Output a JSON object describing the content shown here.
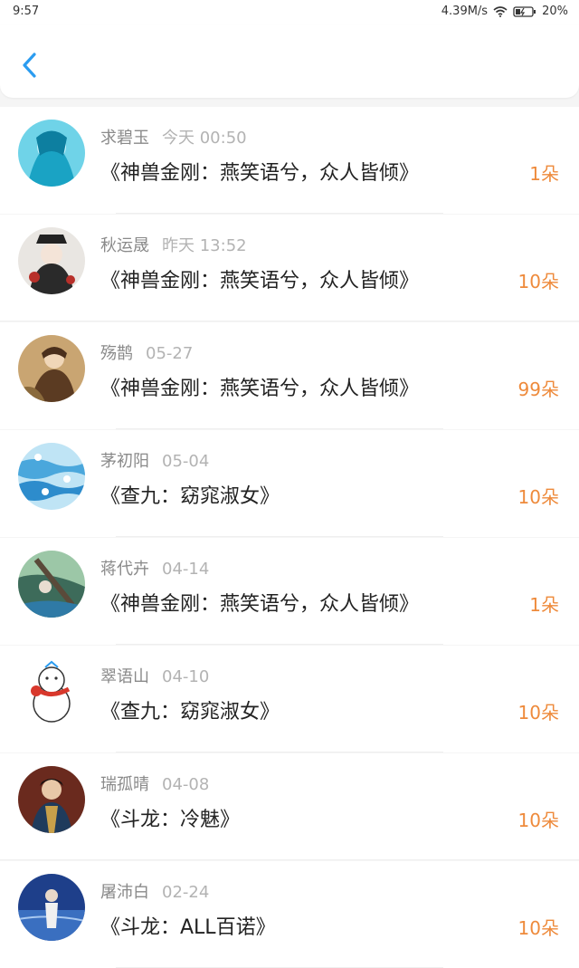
{
  "status": {
    "time": "9:57",
    "speed": "4.39M/s",
    "battery": "20%"
  },
  "header": {
    "back_icon": "chevron-left-icon",
    "accent": "#2b9cf0"
  },
  "items": [
    {
      "name": "求碧玉",
      "date": "今天 00:50",
      "title": "《神兽金刚：燕笑语兮，众人皆倾》",
      "count": "1朵"
    },
    {
      "name": "秋运晟",
      "date": "昨天 13:52",
      "title": "《神兽金刚：燕笑语兮，众人皆倾》",
      "count": "10朵"
    },
    {
      "name": "殇鹊",
      "date": "05-27",
      "title": "《神兽金刚：燕笑语兮，众人皆倾》",
      "count": "99朵"
    },
    {
      "name": "茅初阳",
      "date": "05-04",
      "title": "《查九：窈窕淑女》",
      "count": "10朵"
    },
    {
      "name": "蒋代卉",
      "date": "04-14",
      "title": "《神兽金刚：燕笑语兮，众人皆倾》",
      "count": "1朵"
    },
    {
      "name": "翠语山",
      "date": "04-10",
      "title": "《查九：窈窕淑女》",
      "count": "10朵"
    },
    {
      "name": "瑞孤晴",
      "date": "04-08",
      "title": "《斗龙：冷魅》",
      "count": "10朵"
    },
    {
      "name": "屠沛白",
      "date": "02-24",
      "title": "《斗龙：ALL百诺》",
      "count": "10朵"
    }
  ],
  "colors": {
    "count": "#ee8a3b",
    "name": "#8a8a8a",
    "date": "#b3b3b3",
    "title": "#222222"
  }
}
